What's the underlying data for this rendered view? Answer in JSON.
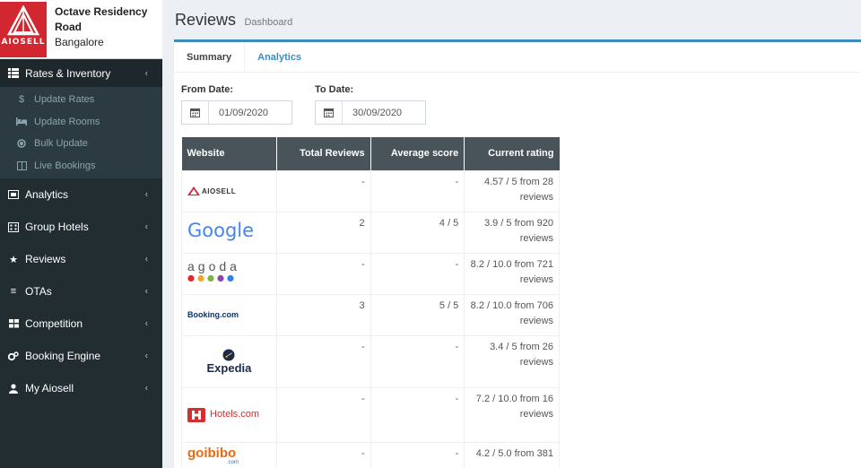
{
  "hotel": {
    "name": "Octave Residency Road",
    "city": "Bangalore",
    "logo_text": "AIOSELL"
  },
  "colors": {
    "sidebar_bg": "#222d32",
    "accent": "#3c8dbc",
    "brand_red": "#d22630",
    "table_header": "#48545a"
  },
  "sidebar": {
    "items": [
      {
        "label": "Rates & Inventory",
        "icon": "table-icon",
        "active": true
      },
      {
        "label": "Analytics",
        "icon": "chart-icon"
      },
      {
        "label": "Group Hotels",
        "icon": "building-icon"
      },
      {
        "label": "Reviews",
        "icon": "star-icon"
      },
      {
        "label": "OTAs",
        "icon": "list-icon"
      },
      {
        "label": "Competition",
        "icon": "grid-icon"
      },
      {
        "label": "Booking Engine",
        "icon": "gears-icon"
      },
      {
        "label": "My Aiosell",
        "icon": "user-icon"
      }
    ],
    "submenu": [
      {
        "label": "Update Rates",
        "icon": "dollar-icon"
      },
      {
        "label": "Update Rooms",
        "icon": "bed-icon"
      },
      {
        "label": "Bulk Update",
        "icon": "circle-icon"
      },
      {
        "label": "Live Bookings",
        "icon": "columns-icon"
      }
    ]
  },
  "header": {
    "title": "Reviews",
    "subtitle": "Dashboard"
  },
  "tabs": [
    {
      "label": "Summary",
      "active": true
    },
    {
      "label": "Analytics",
      "active": false
    }
  ],
  "filters": {
    "from_label": "From Date:",
    "from_value": "01/09/2020",
    "to_label": "To Date:",
    "to_value": "30/09/2020"
  },
  "table": {
    "headers": [
      "Website",
      "Total Reviews",
      "Average score",
      "Current rating"
    ],
    "rows": [
      {
        "site": "AIOSELL",
        "total": "-",
        "avg": "-",
        "rating": "4.57 / 5 from 28 reviews"
      },
      {
        "site": "Google",
        "total": "2",
        "avg": "4 / 5",
        "rating": "3.9 / 5 from 920 reviews"
      },
      {
        "site": "agoda",
        "total": "-",
        "avg": "-",
        "rating": "8.2 / 10.0 from 721 reviews"
      },
      {
        "site": "Booking.com",
        "total": "3",
        "avg": "5 / 5",
        "rating": "8.2 / 10.0 from 706 reviews"
      },
      {
        "site": "Expedia",
        "total": "-",
        "avg": "-",
        "rating": "3.4 / 5 from 26 reviews"
      },
      {
        "site": "Hotels.com",
        "total": "-",
        "avg": "-",
        "rating": "7.2 / 10.0 from 16 reviews"
      },
      {
        "site": "goibibo",
        "site_sub": ".com",
        "total": "-",
        "avg": "-",
        "rating": "4.2 / 5.0 from 381"
      }
    ]
  }
}
